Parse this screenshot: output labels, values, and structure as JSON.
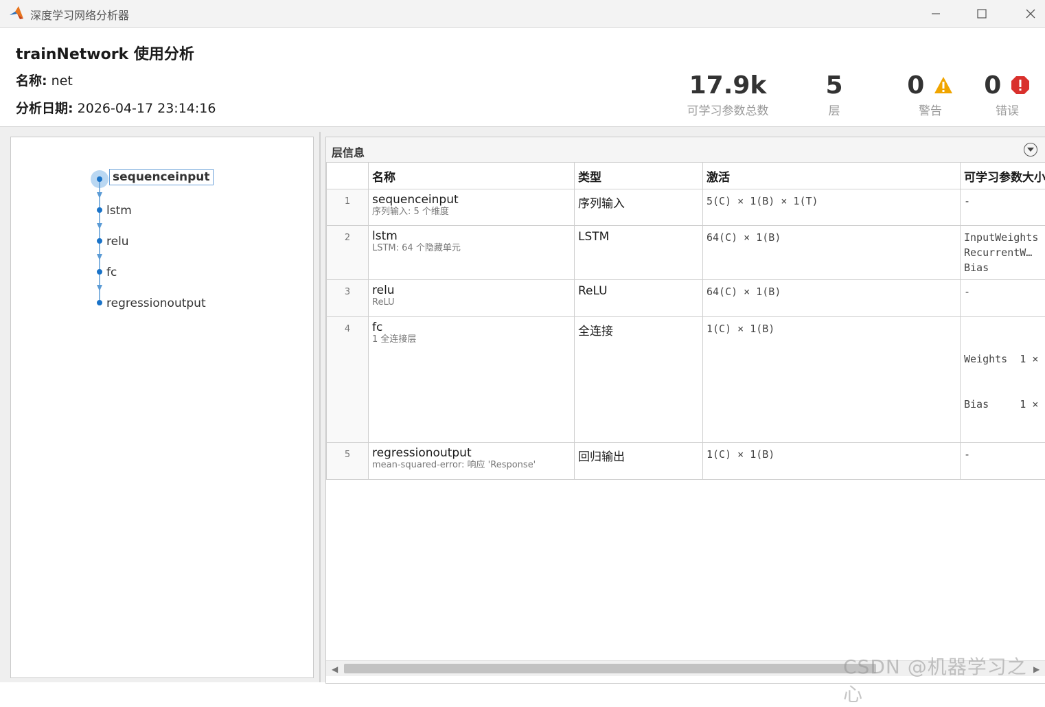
{
  "window": {
    "title": "深度学习网络分析器",
    "controls": [
      "minimize-icon",
      "maximize-icon",
      "close-icon"
    ]
  },
  "header": {
    "title": "trainNetwork 使用分析",
    "name_label": "名称:",
    "name_value": "net",
    "date_label": "分析日期:",
    "date_value": "2026-04-17 23:14:16"
  },
  "stats": [
    {
      "value": "17.9k",
      "label": "可学习参数总数"
    },
    {
      "value": "5",
      "label": "层"
    },
    {
      "value": "0",
      "label": "警告",
      "icon": "warning-icon"
    },
    {
      "value": "0",
      "label": "错误",
      "icon": "error-icon"
    }
  ],
  "graph": {
    "nodes": [
      "sequenceinput",
      "lstm",
      "relu",
      "fc",
      "regressionoutput"
    ],
    "selected": "sequenceinput"
  },
  "layer_panel": {
    "title": "层信息",
    "columns": [
      "名称",
      "类型",
      "激活",
      "可学习参数大小"
    ],
    "rows": [
      {
        "index": "1",
        "name": "sequenceinput",
        "desc": "序列输入: 5 个维度",
        "type": "序列输入",
        "activation": "5(C) × 1(B) × 1(T)",
        "params": [
          "-"
        ]
      },
      {
        "index": "2",
        "name": "lstm",
        "desc": "LSTM: 64 个隐藏单元",
        "type": "LSTM",
        "activation": "64(C) × 1(B)",
        "params": [
          "InputWeights",
          "RecurrentW…",
          "Bias"
        ]
      },
      {
        "index": "3",
        "name": "relu",
        "desc": "ReLU",
        "type": "ReLU",
        "activation": "64(C) × 1(B)",
        "params": [
          "-"
        ]
      },
      {
        "index": "4",
        "name": "fc",
        "desc": "1 全连接层",
        "type": "全连接",
        "activation": "1(C) × 1(B)",
        "params": [
          "Weights  1 ×",
          "Bias     1 ×"
        ]
      },
      {
        "index": "5",
        "name": "regressionoutput",
        "desc": "mean-squared-error: 响应 'Response'",
        "type": "回归输出",
        "activation": "1(C) × 1(B)",
        "params": [
          "-"
        ]
      }
    ]
  },
  "watermark": "CSDN @机器学习之心",
  "colors": {
    "accent": "#1a73c8",
    "warning": "#f0a500",
    "error": "#d9302c"
  }
}
